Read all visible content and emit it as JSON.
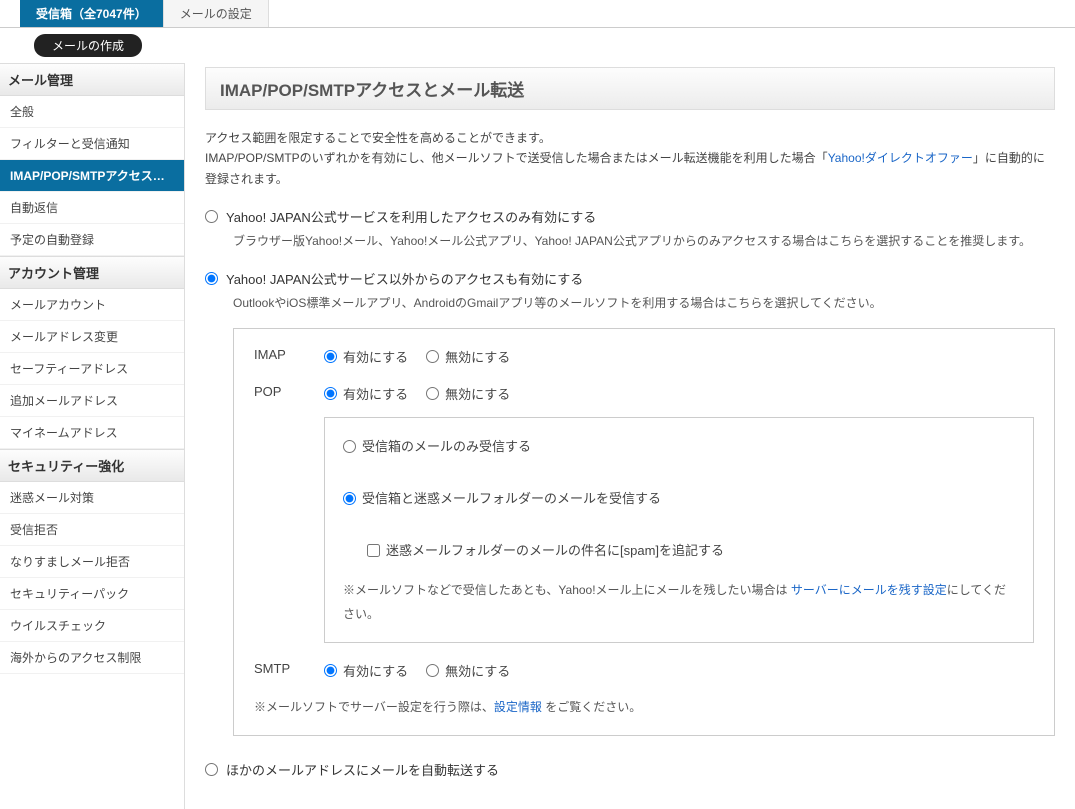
{
  "tabs": {
    "inbox": "受信箱（全7047件）",
    "settings": "メールの設定"
  },
  "compose": "メールの作成",
  "sidebar": {
    "mail_mgmt": {
      "head": "メール管理",
      "items": [
        "全般",
        "フィルターと受信通知",
        "IMAP/POP/SMTPアクセスと…",
        "自動返信",
        "予定の自動登録"
      ]
    },
    "acct_mgmt": {
      "head": "アカウント管理",
      "items": [
        "メールアカウント",
        "メールアドレス変更",
        "セーフティーアドレス",
        "追加メールアドレス",
        "マイネームアドレス"
      ]
    },
    "security": {
      "head": "セキュリティー強化",
      "items": [
        "迷惑メール対策",
        "受信拒否",
        "なりすましメール拒否",
        "セキュリティーパック",
        "ウイルスチェック",
        "海外からのアクセス制限"
      ]
    }
  },
  "page_title": "IMAP/POP/SMTPアクセスとメール転送",
  "desc1": "アクセス範囲を限定することで安全性を高めることができます。",
  "desc2a": "IMAP/POP/SMTPのいずれかを有効にし、他メールソフトで送受信した場合またはメール転送機能を利用した場合「",
  "desc2_link": "Yahoo!ダイレクトオファー",
  "desc2b": "」に自動的に登録されます。",
  "opt1": {
    "label": "Yahoo! JAPAN公式サービスを利用したアクセスのみ有効にする",
    "sub": "ブラウザー版Yahoo!メール、Yahoo!メール公式アプリ、Yahoo! JAPAN公式アプリからのみアクセスする場合はこちらを選択することを推奨します。"
  },
  "opt2": {
    "label": "Yahoo! JAPAN公式サービス以外からのアクセスも有効にする",
    "sub": "OutlookやiOS標準メールアプリ、AndroidのGmailアプリ等のメールソフトを利用する場合はこちらを選択してください。"
  },
  "enable": "有効にする",
  "disable": "無効にする",
  "imap_label": "IMAP",
  "pop_label": "POP",
  "smtp_label": "SMTP",
  "pop_scope": {
    "inbox_only": "受信箱のメールのみ受信する",
    "inbox_spam": "受信箱と迷惑メールフォルダーのメールを受信する",
    "spam_tag": "迷惑メールフォルダーのメールの件名に[spam]を追記する",
    "note_a": "※メールソフトなどで受信したあとも、Yahoo!メール上にメールを残したい場合は ",
    "note_link": "サーバーにメールを残す設定",
    "note_b": "にしてください。"
  },
  "server_note_a": "※メールソフトでサーバー設定を行う際は、",
  "server_note_link": "設定情報",
  "server_note_b": " をご覧ください。",
  "opt3": "ほかのメールアドレスにメールを自動転送する"
}
